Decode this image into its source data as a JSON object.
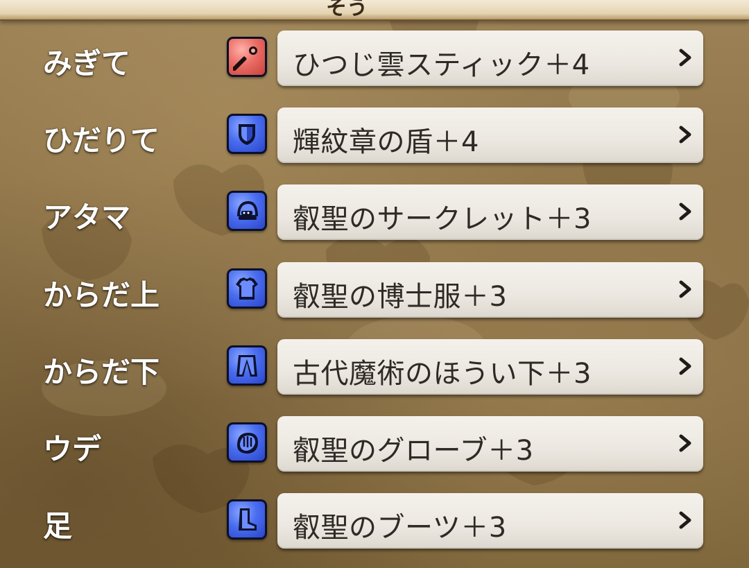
{
  "header": {
    "title_fragment": "そう"
  },
  "equipment": [
    {
      "slot": "みぎて",
      "item": "ひつじ雲スティック＋4",
      "icon": "staff-icon",
      "icon_color": "#e0625c"
    },
    {
      "slot": "ひだりて",
      "item": "輝紋章の盾＋4",
      "icon": "shield-icon",
      "icon_color": "#3f63e6"
    },
    {
      "slot": "アタマ",
      "item": "叡聖のサークレット＋3",
      "icon": "helmet-icon",
      "icon_color": "#3f63e6"
    },
    {
      "slot": "からだ上",
      "item": "叡聖の博士服＋3",
      "icon": "armor-icon",
      "icon_color": "#3f63e6"
    },
    {
      "slot": "からだ下",
      "item": "古代魔術のほうい下＋3",
      "icon": "pants-icon",
      "icon_color": "#3f63e6"
    },
    {
      "slot": "ウデ",
      "item": "叡聖のグローブ＋3",
      "icon": "glove-icon",
      "icon_color": "#3f63e6"
    },
    {
      "slot": "足",
      "item": "叡聖のブーツ＋3",
      "icon": "boots-icon",
      "icon_color": "#3f63e6"
    }
  ]
}
